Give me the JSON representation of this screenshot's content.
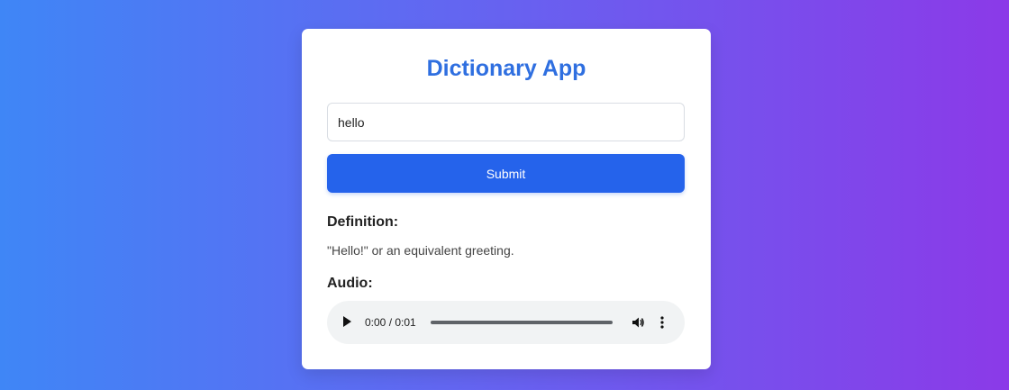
{
  "app": {
    "title": "Dictionary App"
  },
  "search": {
    "value": "hello",
    "submit_label": "Submit"
  },
  "result": {
    "definition_heading": "Definition:",
    "definition_text": "\"Hello!\" or an equivalent greeting.",
    "audio_heading": "Audio:"
  },
  "audio": {
    "time": "0:00 / 0:01",
    "progress_fraction": 0,
    "play_icon": "play-icon",
    "volume_icon": "volume-icon",
    "more_icon": "more-options-icon"
  },
  "colors": {
    "accent": "#2563eb",
    "title": "#2f6fe0",
    "gradient_start": "#3f86f6",
    "gradient_end": "#8b3ae8"
  }
}
